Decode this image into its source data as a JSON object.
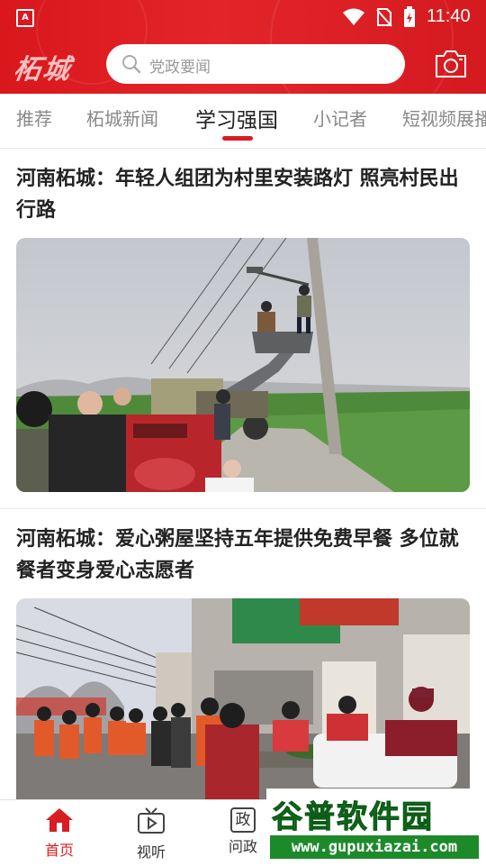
{
  "status_bar": {
    "app_indicator": "A",
    "time": "11:40"
  },
  "header": {
    "logo_text": "柘城",
    "search_placeholder": "党政要闻",
    "brand_color": "#e2231a"
  },
  "tabs": [
    {
      "label": "推荐",
      "active": false
    },
    {
      "label": "柘城新闻",
      "active": false
    },
    {
      "label": "学习强国",
      "active": true
    },
    {
      "label": "小记者",
      "active": false
    },
    {
      "label": "短视频展播",
      "active": false
    }
  ],
  "articles": [
    {
      "title": "河南柘城：年轻人组团为村里安装路灯 照亮村民出行路"
    },
    {
      "title": "河南柘城：爱心粥屋坚持五年提供免费早餐 多位就餐者变身爱心志愿者"
    }
  ],
  "bottom_nav": [
    {
      "label": "首页",
      "icon": "home-icon",
      "active": true
    },
    {
      "label": "视听",
      "icon": "tv-play-icon",
      "active": false
    },
    {
      "label": "问政",
      "icon": "zheng-badge-icon",
      "glyph": "政",
      "active": false
    }
  ],
  "watermark": {
    "text": "谷普软件园",
    "url": "www.gupuxiazai.com"
  }
}
